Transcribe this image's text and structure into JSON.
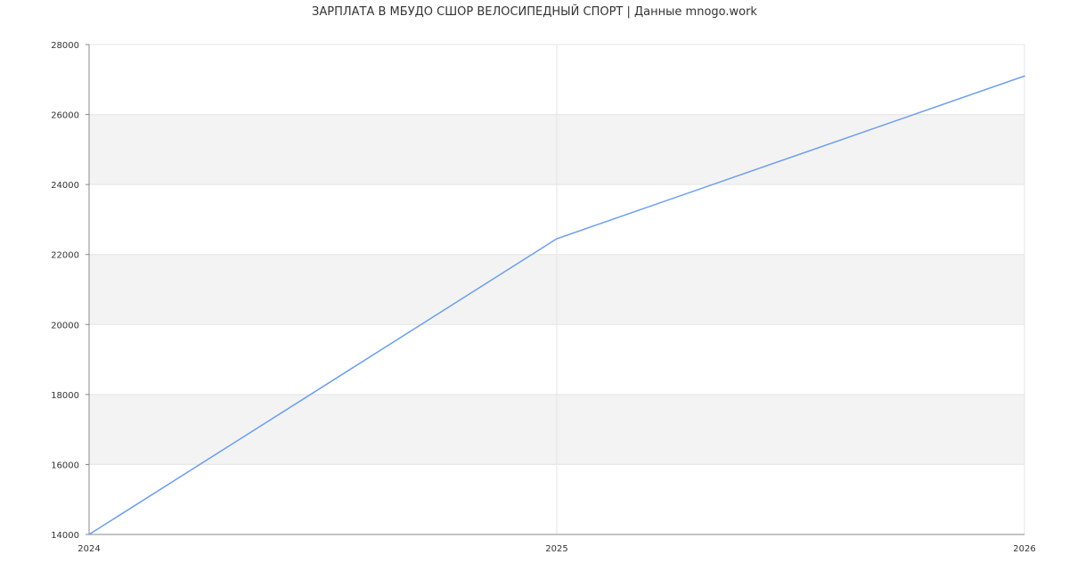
{
  "chart_data": {
    "type": "line",
    "title": "ЗАРПЛАТА В МБУДО СШОР ВЕЛОСИПЕДНЫЙ СПОРТ | Данные mnogo.work",
    "xlabel": "",
    "ylabel": "",
    "x": [
      "2024",
      "2025",
      "2026"
    ],
    "series": [
      {
        "values": [
          14000,
          22450,
          27100
        ]
      }
    ],
    "ylim": [
      14000,
      28000
    ],
    "yticks": [
      14000,
      16000,
      18000,
      20000,
      22000,
      24000,
      26000,
      28000
    ],
    "grid": true,
    "legend": "none",
    "colors": {
      "line": "#6d9eeb",
      "band": "#f3f3f3",
      "grid": "#e4e4e4",
      "axis": "#888888",
      "text": "#333333"
    }
  }
}
